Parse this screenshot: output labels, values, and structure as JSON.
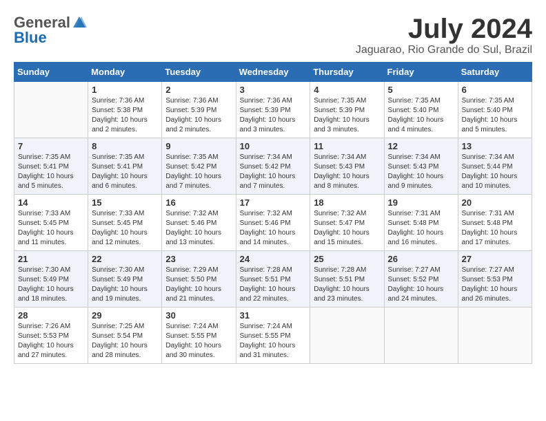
{
  "header": {
    "logo_general": "General",
    "logo_blue": "Blue",
    "month_title": "July 2024",
    "location": "Jaguarao, Rio Grande do Sul, Brazil"
  },
  "weekdays": [
    "Sunday",
    "Monday",
    "Tuesday",
    "Wednesday",
    "Thursday",
    "Friday",
    "Saturday"
  ],
  "weeks": [
    [
      {
        "day": "",
        "info": ""
      },
      {
        "day": "1",
        "info": "Sunrise: 7:36 AM\nSunset: 5:38 PM\nDaylight: 10 hours\nand 2 minutes."
      },
      {
        "day": "2",
        "info": "Sunrise: 7:36 AM\nSunset: 5:39 PM\nDaylight: 10 hours\nand 2 minutes."
      },
      {
        "day": "3",
        "info": "Sunrise: 7:36 AM\nSunset: 5:39 PM\nDaylight: 10 hours\nand 3 minutes."
      },
      {
        "day": "4",
        "info": "Sunrise: 7:35 AM\nSunset: 5:39 PM\nDaylight: 10 hours\nand 3 minutes."
      },
      {
        "day": "5",
        "info": "Sunrise: 7:35 AM\nSunset: 5:40 PM\nDaylight: 10 hours\nand 4 minutes."
      },
      {
        "day": "6",
        "info": "Sunrise: 7:35 AM\nSunset: 5:40 PM\nDaylight: 10 hours\nand 5 minutes."
      }
    ],
    [
      {
        "day": "7",
        "info": "Sunrise: 7:35 AM\nSunset: 5:41 PM\nDaylight: 10 hours\nand 5 minutes."
      },
      {
        "day": "8",
        "info": "Sunrise: 7:35 AM\nSunset: 5:41 PM\nDaylight: 10 hours\nand 6 minutes."
      },
      {
        "day": "9",
        "info": "Sunrise: 7:35 AM\nSunset: 5:42 PM\nDaylight: 10 hours\nand 7 minutes."
      },
      {
        "day": "10",
        "info": "Sunrise: 7:34 AM\nSunset: 5:42 PM\nDaylight: 10 hours\nand 7 minutes."
      },
      {
        "day": "11",
        "info": "Sunrise: 7:34 AM\nSunset: 5:43 PM\nDaylight: 10 hours\nand 8 minutes."
      },
      {
        "day": "12",
        "info": "Sunrise: 7:34 AM\nSunset: 5:43 PM\nDaylight: 10 hours\nand 9 minutes."
      },
      {
        "day": "13",
        "info": "Sunrise: 7:34 AM\nSunset: 5:44 PM\nDaylight: 10 hours\nand 10 minutes."
      }
    ],
    [
      {
        "day": "14",
        "info": "Sunrise: 7:33 AM\nSunset: 5:45 PM\nDaylight: 10 hours\nand 11 minutes."
      },
      {
        "day": "15",
        "info": "Sunrise: 7:33 AM\nSunset: 5:45 PM\nDaylight: 10 hours\nand 12 minutes."
      },
      {
        "day": "16",
        "info": "Sunrise: 7:32 AM\nSunset: 5:46 PM\nDaylight: 10 hours\nand 13 minutes."
      },
      {
        "day": "17",
        "info": "Sunrise: 7:32 AM\nSunset: 5:46 PM\nDaylight: 10 hours\nand 14 minutes."
      },
      {
        "day": "18",
        "info": "Sunrise: 7:32 AM\nSunset: 5:47 PM\nDaylight: 10 hours\nand 15 minutes."
      },
      {
        "day": "19",
        "info": "Sunrise: 7:31 AM\nSunset: 5:48 PM\nDaylight: 10 hours\nand 16 minutes."
      },
      {
        "day": "20",
        "info": "Sunrise: 7:31 AM\nSunset: 5:48 PM\nDaylight: 10 hours\nand 17 minutes."
      }
    ],
    [
      {
        "day": "21",
        "info": "Sunrise: 7:30 AM\nSunset: 5:49 PM\nDaylight: 10 hours\nand 18 minutes."
      },
      {
        "day": "22",
        "info": "Sunrise: 7:30 AM\nSunset: 5:49 PM\nDaylight: 10 hours\nand 19 minutes."
      },
      {
        "day": "23",
        "info": "Sunrise: 7:29 AM\nSunset: 5:50 PM\nDaylight: 10 hours\nand 21 minutes."
      },
      {
        "day": "24",
        "info": "Sunrise: 7:28 AM\nSunset: 5:51 PM\nDaylight: 10 hours\nand 22 minutes."
      },
      {
        "day": "25",
        "info": "Sunrise: 7:28 AM\nSunset: 5:51 PM\nDaylight: 10 hours\nand 23 minutes."
      },
      {
        "day": "26",
        "info": "Sunrise: 7:27 AM\nSunset: 5:52 PM\nDaylight: 10 hours\nand 24 minutes."
      },
      {
        "day": "27",
        "info": "Sunrise: 7:27 AM\nSunset: 5:53 PM\nDaylight: 10 hours\nand 26 minutes."
      }
    ],
    [
      {
        "day": "28",
        "info": "Sunrise: 7:26 AM\nSunset: 5:53 PM\nDaylight: 10 hours\nand 27 minutes."
      },
      {
        "day": "29",
        "info": "Sunrise: 7:25 AM\nSunset: 5:54 PM\nDaylight: 10 hours\nand 28 minutes."
      },
      {
        "day": "30",
        "info": "Sunrise: 7:24 AM\nSunset: 5:55 PM\nDaylight: 10 hours\nand 30 minutes."
      },
      {
        "day": "31",
        "info": "Sunrise: 7:24 AM\nSunset: 5:55 PM\nDaylight: 10 hours\nand 31 minutes."
      },
      {
        "day": "",
        "info": ""
      },
      {
        "day": "",
        "info": ""
      },
      {
        "day": "",
        "info": ""
      }
    ]
  ]
}
